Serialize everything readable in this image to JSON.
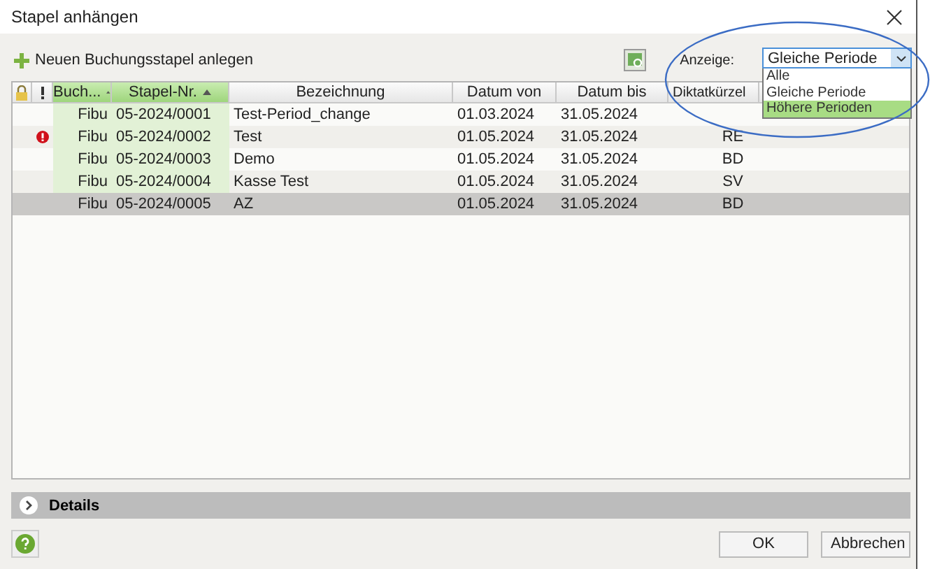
{
  "window": {
    "title": "Stapel anhängen"
  },
  "toolbar": {
    "new_button": "Neuen Buchungsstapel anlegen",
    "filter_label": "Anzeige:",
    "filter_value": "Gleiche Periode",
    "filter_options": [
      {
        "label": "Alle",
        "selected": false
      },
      {
        "label": "Gleiche Periode",
        "selected": false
      },
      {
        "label": "Höhere Perioden",
        "selected": true
      }
    ]
  },
  "table": {
    "columns": [
      {
        "kind": "lock",
        "sorted": false
      },
      {
        "kind": "flag",
        "sorted": false
      },
      {
        "label": "Buch...",
        "kind": "text",
        "sorted": true
      },
      {
        "label": "Stapel-Nr.",
        "kind": "text",
        "sorted": true
      },
      {
        "label": "Bezeichnung",
        "kind": "text",
        "sorted": false
      },
      {
        "label": "Datum von",
        "kind": "text",
        "sorted": false
      },
      {
        "label": "Datum bis",
        "kind": "text",
        "sorted": false
      },
      {
        "label": "Diktatkürzel",
        "kind": "text",
        "sorted": false
      }
    ],
    "rows": [
      {
        "error": false,
        "book": "Fibu",
        "number": "05-2024/0001",
        "name": "Test-Period_change",
        "from": "01.03.2024",
        "to": "31.05.2024",
        "selected": false
      },
      {
        "error": true,
        "book": "Fibu",
        "number": "05-2024/0002",
        "name": "Test",
        "from": "01.05.2024",
        "to": "31.05.2024",
        "initials": "RE",
        "selected": false
      },
      {
        "error": false,
        "book": "Fibu",
        "number": "05-2024/0003",
        "name": "Demo",
        "from": "01.05.2024",
        "to": "31.05.2024",
        "initials": "BD",
        "selected": false
      },
      {
        "error": false,
        "book": "Fibu",
        "number": "05-2024/0004",
        "name": "Kasse Test",
        "from": "01.05.2024",
        "to": "31.05.2024",
        "initials": "SV",
        "selected": false
      },
      {
        "error": false,
        "book": "Fibu",
        "number": "05-2024/0005",
        "name": "AZ",
        "from": "01.05.2024",
        "to": "31.05.2024",
        "initials": "BD",
        "selected": true
      }
    ]
  },
  "details": {
    "label": "Details",
    "expanded": false
  },
  "buttons": [
    "OK",
    "Abbrechen"
  ]
}
